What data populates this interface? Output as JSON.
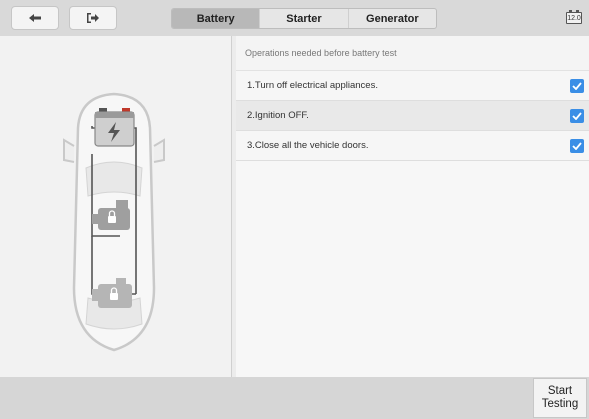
{
  "toolbar": {
    "back_icon": "arrow-left-icon",
    "exit_icon": "exit-icon",
    "tabs": [
      {
        "label": "Battery",
        "active": true
      },
      {
        "label": "Starter",
        "active": false
      },
      {
        "label": "Generator",
        "active": false
      }
    ],
    "battery_voltage": "12.0"
  },
  "checklist": {
    "header": "Operations needed before battery test",
    "items": [
      {
        "label": "1.Turn off electrical appliances.",
        "checked": true
      },
      {
        "label": "2.Ignition OFF.",
        "checked": true
      },
      {
        "label": "3.Close all the vehicle doors.",
        "checked": true
      }
    ]
  },
  "footer": {
    "start_line1": "Start",
    "start_line2": "Testing"
  },
  "colors": {
    "accent": "#3a8ee6",
    "topbar": "#d9d9d9",
    "bottombar": "#d6d6d6"
  }
}
